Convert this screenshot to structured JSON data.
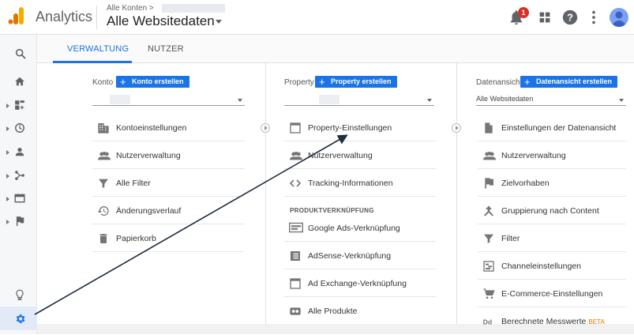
{
  "header": {
    "app_title": "Analytics",
    "account_small": "Alle Konten >",
    "account_big": "Alle Websitedaten",
    "notification_count": "1"
  },
  "tabs": [
    {
      "label": "VERWALTUNG",
      "active": true
    },
    {
      "label": "NUTZER",
      "active": false
    }
  ],
  "columns": {
    "konto": {
      "label": "Konto",
      "button": "Konto erstellen",
      "select_value": "",
      "items": [
        {
          "icon": "building-icon",
          "label": "Kontoeinstellungen"
        },
        {
          "icon": "people-icon",
          "label": "Nutzerverwaltung"
        },
        {
          "icon": "filter-icon",
          "label": "Alle Filter"
        },
        {
          "icon": "history-icon",
          "label": "Änderungsverlauf"
        },
        {
          "icon": "trash-icon",
          "label": "Papierkorb"
        }
      ]
    },
    "property": {
      "label": "Property",
      "button": "Property erstellen",
      "select_value": "",
      "items": [
        {
          "icon": "window-icon",
          "label": "Property-Einstellungen"
        },
        {
          "icon": "people-icon",
          "label": "Nutzerverwaltung"
        },
        {
          "icon": "code-icon",
          "label": "Tracking-Informationen"
        }
      ],
      "section_head": "PRODUKTVERKNÜPFUNG",
      "linked_items": [
        {
          "icon": "google-ads-icon",
          "label": "Google Ads-Verknüpfung"
        },
        {
          "icon": "adsense-icon",
          "label": "AdSense-Verknüpfung"
        },
        {
          "icon": "ad-exchange-icon",
          "label": "Ad Exchange-Verknüpfung"
        },
        {
          "icon": "link-icon",
          "label": "Alle Produkte"
        }
      ]
    },
    "view": {
      "label": "Datenansicht",
      "button": "Datenansicht erstellen",
      "select_value": "Alle Websitedaten",
      "items": [
        {
          "icon": "document-icon",
          "label": "Einstellungen der Datenansicht"
        },
        {
          "icon": "people-icon",
          "label": "Nutzerverwaltung"
        },
        {
          "icon": "flag-icon",
          "label": "Zielvorhaben"
        },
        {
          "icon": "grouping-icon",
          "label": "Gruppierung nach Content"
        },
        {
          "icon": "filter-icon",
          "label": "Filter"
        },
        {
          "icon": "channel-icon",
          "label": "Channeleinstellungen"
        },
        {
          "icon": "cart-icon",
          "label": "E-Commerce-Einstellungen"
        },
        {
          "icon": "dd-icon",
          "label": "Berechnete Messwerte",
          "badge": "BETA"
        }
      ]
    }
  },
  "colors": {
    "accent": "#1a73e8",
    "badge": "#d93025",
    "annotation": "#1f2d3d"
  }
}
